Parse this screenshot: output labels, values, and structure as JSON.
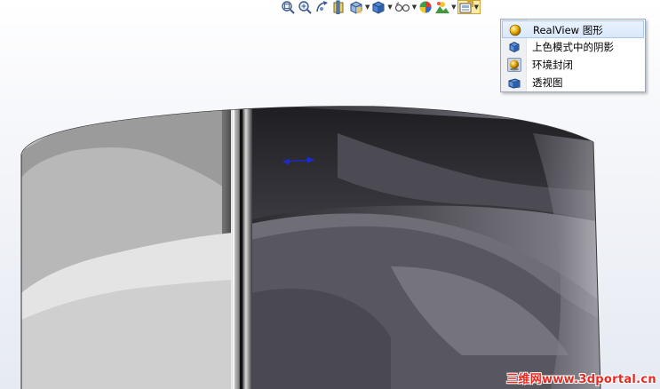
{
  "toolbar": {
    "buttons": [
      {
        "icon": "zoom-to-fit-icon"
      },
      {
        "icon": "zoom-to-area-icon"
      },
      {
        "icon": "previous-view-icon"
      },
      {
        "icon": "section-view-icon"
      },
      {
        "icon": "view-orientation-icon",
        "dropdown": true
      },
      {
        "icon": "display-style-icon",
        "dropdown": true
      },
      {
        "icon": "hide-show-items-icon",
        "dropdown": true
      },
      {
        "icon": "edit-appearance-icon"
      },
      {
        "icon": "apply-scene-icon",
        "dropdown": true
      },
      {
        "icon": "view-settings-icon",
        "dropdown": true,
        "active": true
      }
    ]
  },
  "view_settings_menu": {
    "items": [
      {
        "label": "RealView 图形",
        "icon": "realview-icon",
        "highlighted": true
      },
      {
        "label": "上色模式中的阴影",
        "icon": "shadows-icon"
      },
      {
        "label": "环境封闭",
        "icon": "ambient-occlusion-icon",
        "checked": true
      },
      {
        "label": "透视图",
        "icon": "perspective-icon"
      }
    ]
  },
  "watermark": "三维网www.3dportal.cn",
  "colors": {
    "menu_highlight": "#d9e8fa",
    "toolbar_active": "#fbe9a6",
    "watermark": "#e8281f",
    "triad_arrow": "#1a2bd6"
  }
}
